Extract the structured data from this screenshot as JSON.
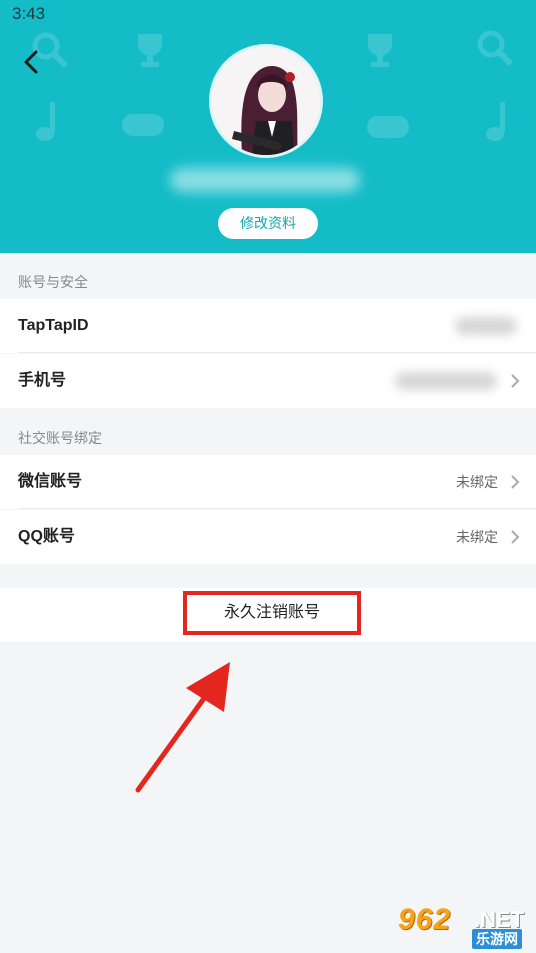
{
  "status_bar": {
    "time": "3:43"
  },
  "header": {
    "edit_profile_label": "修改资料"
  },
  "sections": {
    "account_security": "账号与安全",
    "social_binding": "社交账号绑定"
  },
  "rows": {
    "taptap_id": {
      "label": "TapTapID"
    },
    "phone": {
      "label": "手机号"
    },
    "wechat": {
      "label": "微信账号",
      "value": "未绑定"
    },
    "qq": {
      "label": "QQ账号",
      "value": "未绑定"
    }
  },
  "actions": {
    "delete_account_label": "永久注销账号"
  },
  "watermark": {
    "brand": "962",
    "suffix": ".NET",
    "subtitle": "乐游网"
  },
  "colors": {
    "header_bg": "#14bcc8",
    "highlight": "#e3261e",
    "accent_text": "#14a7b2"
  },
  "icons": [
    "back-arrow-icon",
    "chevron-right-icon",
    "trophy-icon",
    "music-note-icon",
    "gamepad-icon",
    "search-icon"
  ]
}
